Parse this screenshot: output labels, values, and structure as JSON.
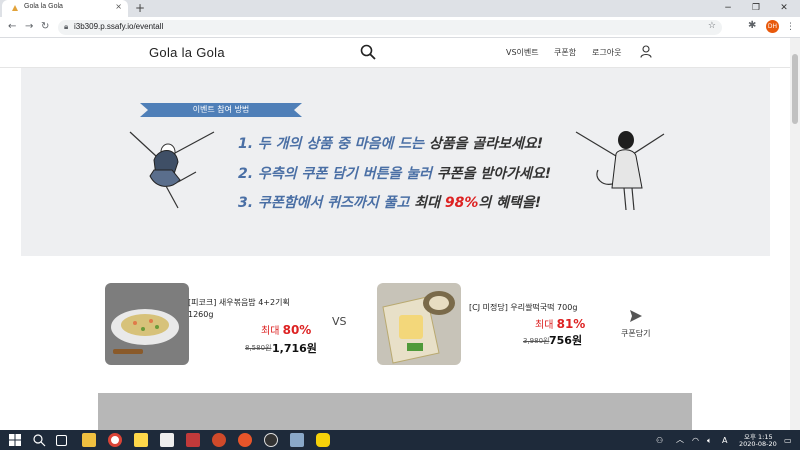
{
  "browser": {
    "tab_title": "Gola la Gola",
    "tab_close": "×",
    "new_tab": "+",
    "url": "i3b309.p.ssafy.io/eventall",
    "profile_initials": "DH",
    "win_min": "−",
    "win_max": "❐",
    "win_close": "✕"
  },
  "header": {
    "brand": "Gola la Gola",
    "nav": [
      "VS이벤트",
      "쿠폰함",
      "로그아웃"
    ]
  },
  "banner": {
    "ribbon_label": "이벤트 참여 방법",
    "step1": {
      "blue": "1. 두 개의 상품 중 마음에 드는 ",
      "dark": "상품을 골라보세요!"
    },
    "step2": {
      "blue": "2. 우측의 쿠폰 담기 버튼을 눌러 ",
      "dark": "쿠폰을 받아가세요!"
    },
    "step3": {
      "blue": "3. 쿠폰함에서 퀴즈까지 풀고 ",
      "dark": "최대 ",
      "red": "98%",
      "tail": "의 혜택을!"
    }
  },
  "products": [
    {
      "name": "[피코크] 새우볶음밥 4+2기획",
      "weight": "1260g",
      "discount_prefix": "최대 ",
      "discount": "80%",
      "old_price": "8,580원",
      "new_price": "1,716원"
    },
    {
      "name": "[CJ 미정당] 우리쌀떡국떡 700g",
      "weight": "",
      "discount_prefix": "최대 ",
      "discount": "81%",
      "old_price": "3,980원",
      "new_price": "756원"
    }
  ],
  "vs_label": "VS",
  "coupon_button": "쿠폰담기",
  "taskbar": {
    "time": "오후 1:15",
    "date": "2020-08-20"
  },
  "colors": {
    "accent_blue": "#4a6fa5",
    "discount_red": "#dd2222",
    "banner_bg": "#eeeff1"
  }
}
